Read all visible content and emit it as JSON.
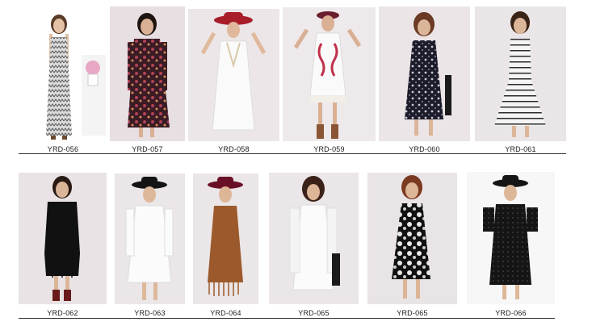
{
  "catalog": {
    "row1": [
      {
        "code": "YRD-056"
      },
      {
        "code": "YRD-057"
      },
      {
        "code": "YRD-058"
      },
      {
        "code": "YRD-059"
      },
      {
        "code": "YRD-060"
      },
      {
        "code": "YRD-061"
      }
    ],
    "row2": [
      {
        "code": "YRD-062"
      },
      {
        "code": "YRD-063"
      },
      {
        "code": "YRD-064"
      },
      {
        "code": "YRD-065"
      },
      {
        "code": "YRD-065"
      },
      {
        "code": "YRD-066"
      }
    ]
  }
}
